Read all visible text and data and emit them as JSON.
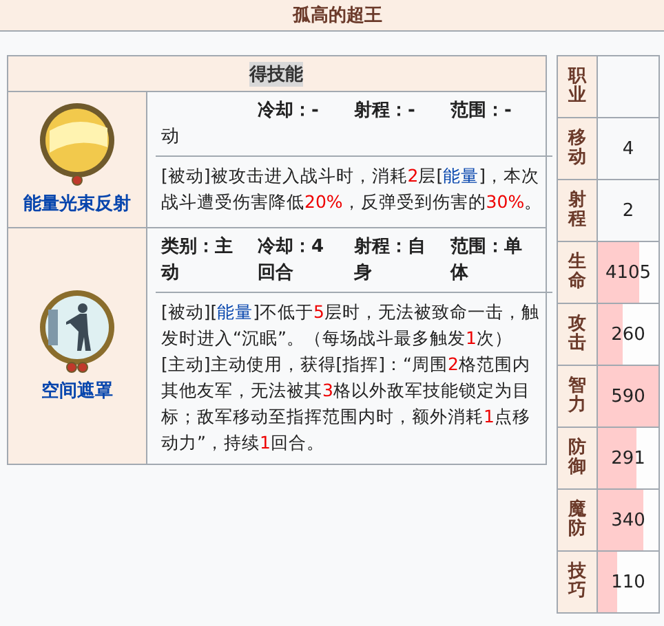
{
  "title": "孤高的超王",
  "skills_header": "得技能",
  "skills": [
    {
      "name": "能量光束反射",
      "category": "动",
      "cooldown": "冷却：-",
      "range": "射程：-",
      "area": "范围：-",
      "paragraphs": [
        [
          {
            "kind": "plain",
            "text": "[被动]被攻击进入战斗时，消耗"
          },
          {
            "kind": "number",
            "text": "2"
          },
          {
            "kind": "plain",
            "text": "层["
          },
          {
            "kind": "link",
            "text": "能量"
          },
          {
            "kind": "plain",
            "text": "]，本次战斗遭受伤害降低"
          },
          {
            "kind": "number",
            "text": "20%"
          },
          {
            "kind": "plain",
            "text": "，反弹受到伤害的"
          },
          {
            "kind": "number",
            "text": "30%"
          },
          {
            "kind": "plain",
            "text": "。"
          }
        ]
      ]
    },
    {
      "name": "空间遮罩",
      "category": "类别：主动",
      "cooldown": "冷却：4回合",
      "range": "射程：自身",
      "area": "范围：单体",
      "paragraphs": [
        [
          {
            "kind": "plain",
            "text": "[被动]["
          },
          {
            "kind": "link",
            "text": "能量"
          },
          {
            "kind": "plain",
            "text": "]不低于"
          },
          {
            "kind": "number",
            "text": "5"
          },
          {
            "kind": "plain",
            "text": "层时，无法被致命一击，触发时进入“沉眠”。（每场战斗最多触发"
          },
          {
            "kind": "number",
            "text": "1"
          },
          {
            "kind": "plain",
            "text": "次）"
          }
        ],
        [
          {
            "kind": "plain",
            "text": "[主动]主动使用，获得[指挥]：“周围"
          },
          {
            "kind": "number",
            "text": "2"
          },
          {
            "kind": "plain",
            "text": "格范围内其他友军，无法被其"
          },
          {
            "kind": "number",
            "text": "3"
          },
          {
            "kind": "plain",
            "text": "格以外敌军技能锁定为目标；敌军移动至指挥范围内时，额外消耗"
          },
          {
            "kind": "number",
            "text": "1"
          },
          {
            "kind": "plain",
            "text": "点移动力”，持续"
          },
          {
            "kind": "number",
            "text": "1"
          },
          {
            "kind": "plain",
            "text": "回合。"
          }
        ]
      ]
    }
  ],
  "stats": [
    {
      "label": "职业"
    },
    {
      "label": "移动",
      "value": "4"
    },
    {
      "label": "射程",
      "value": "2"
    },
    {
      "label": "生命",
      "value": "4105",
      "level": 0.68
    },
    {
      "label": "攻击",
      "value": "260",
      "level": 0.41
    },
    {
      "label": "智力",
      "value": "590",
      "level": 1
    },
    {
      "label": "防御",
      "value": "291",
      "level": 0.64
    },
    {
      "label": "魔防",
      "value": "340",
      "level": 0.75
    },
    {
      "label": "技巧",
      "value": "110",
      "level": 0.32
    }
  ]
}
